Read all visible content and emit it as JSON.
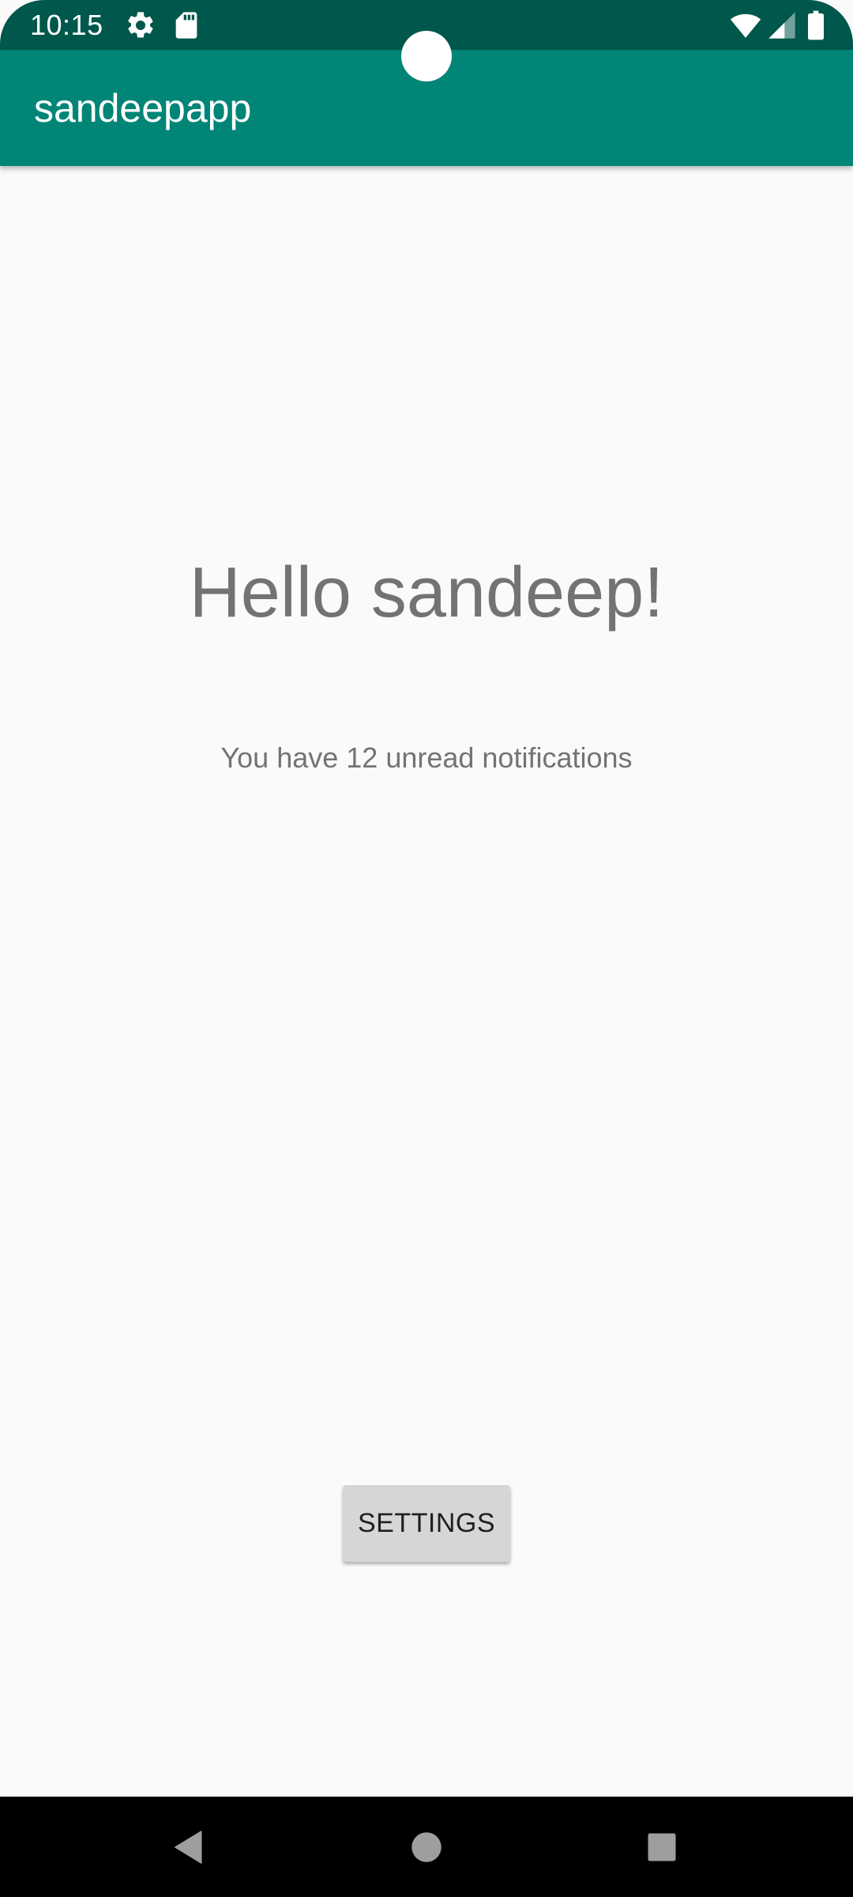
{
  "status_bar": {
    "time": "10:15",
    "icons": [
      "settings-gear-icon",
      "sd-card-icon",
      "wifi-icon",
      "cell-signal-icon",
      "battery-icon"
    ]
  },
  "app_bar": {
    "title": "sandeepapp"
  },
  "main": {
    "greeting": "Hello sandeep!",
    "notifications_text": "You have 12 unread notifications",
    "settings_button_label": "SETTINGS"
  },
  "nav_bar": {
    "buttons": [
      "back-icon",
      "home-icon",
      "recents-icon"
    ]
  },
  "colors": {
    "status_bar": "#00574b",
    "app_bar": "#008577",
    "background": "#fafafa",
    "text_secondary": "#737373",
    "button_bg": "#d6d6d6"
  }
}
